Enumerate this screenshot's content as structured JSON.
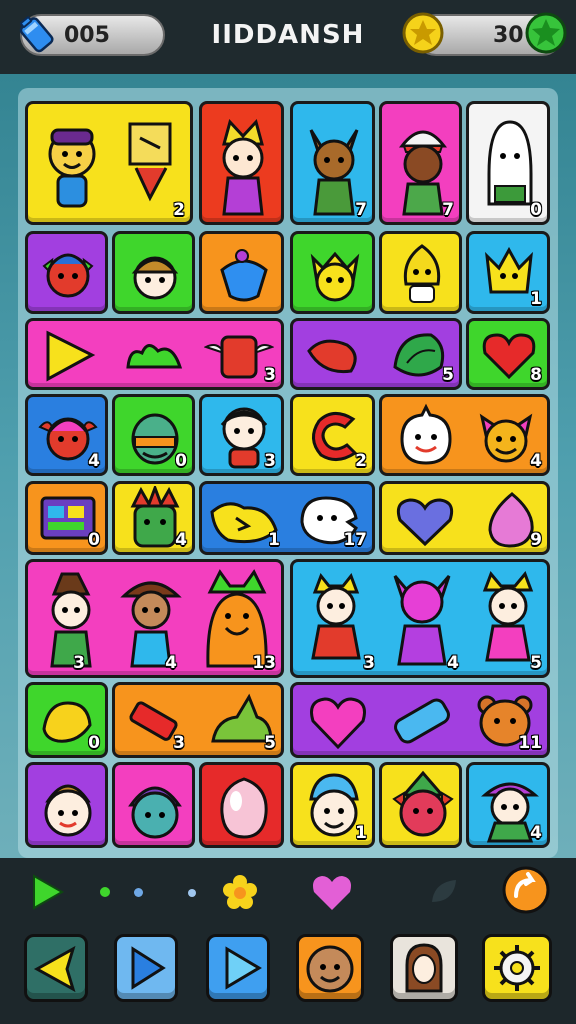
{
  "header": {
    "title": "IIDDANSH",
    "lives_value": "005",
    "coins_value": "30",
    "lives_icon": "battery-icon",
    "coin_icon": "star-coin-icon",
    "add_icon": "plus-star-icon"
  },
  "tile_numbers": {
    "r1": [
      "2",
      "7",
      "7",
      "0"
    ],
    "r2": [
      "1"
    ],
    "r3": [
      "3",
      "5",
      "8"
    ],
    "r4": [
      "4",
      "0",
      "3",
      "2",
      "4"
    ],
    "r5": [
      "0",
      "4",
      "1",
      "17",
      "9"
    ],
    "r6": [
      "3",
      "4",
      "13",
      "3",
      "4",
      "5"
    ],
    "r7": [
      "0",
      "3",
      "5",
      "11"
    ],
    "r8": [
      "1",
      "4"
    ]
  },
  "bottom_bar": {
    "play_icon": "play-icon",
    "flower_icon": "flower-icon",
    "heart_icon": "heart-icon",
    "leaf_icon": "leaf-icon",
    "refresh_icon": "refresh-icon",
    "buttons": [
      "back-button",
      "play-button",
      "next-button",
      "character-button",
      "portrait-button",
      "settings-button"
    ]
  },
  "colors": {
    "yellow": "#f7e11c",
    "red": "#ec3b1f",
    "blue": "#2fb8ec",
    "pink": "#f33fbf",
    "purple": "#a23fe0",
    "green": "#3fd62c",
    "orange": "#f7941d",
    "white": "#f4f4f4"
  }
}
